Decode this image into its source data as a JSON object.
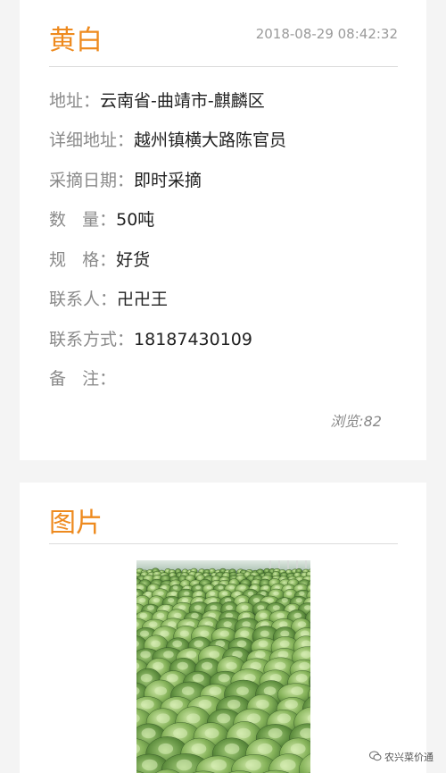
{
  "info": {
    "title": "黄白",
    "date": "2018-08-29 08:42:32",
    "fields": [
      {
        "label": "地址：",
        "value": "云南省-曲靖市-麒麟区"
      },
      {
        "label": "详细地址：",
        "value": "越州镇横大路陈官员"
      },
      {
        "label": "采摘日期：",
        "value": "即时采摘"
      },
      {
        "label": "数   量：",
        "value": "50吨"
      },
      {
        "label": "规   格：",
        "value": "好货"
      },
      {
        "label": "联系人：",
        "value": "卍卍王"
      },
      {
        "label": "联系方式：",
        "value": "18187430109"
      },
      {
        "label": "备   注：",
        "value": ""
      }
    ],
    "views": "浏览:82"
  },
  "images": {
    "title": "图片",
    "photo_icon": "cabbage-field-photo"
  },
  "watermark": {
    "icon": "wechat-icon",
    "text": "农兴菜价通"
  }
}
